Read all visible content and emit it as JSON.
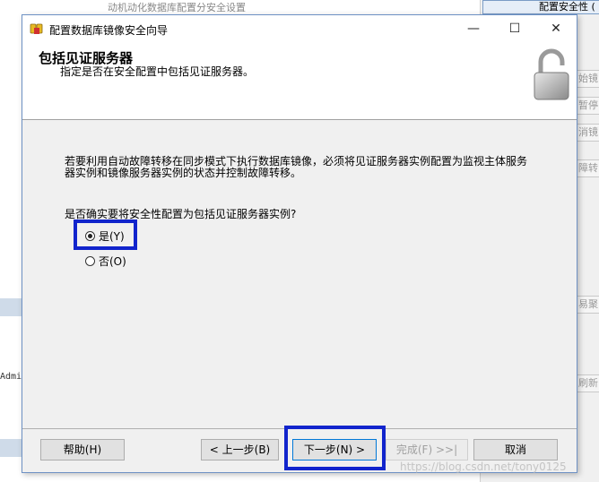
{
  "background": {
    "top_fragment": "动机动化数据库配置分安全设置",
    "right_tab": "配置安全性 (",
    "right_fragments": [
      "始镜",
      "暂停",
      "消镜",
      "障转",
      "易聚",
      "刷新"
    ],
    "left_text": "Admi"
  },
  "dialog": {
    "title": "配置数据库镜像安全向导",
    "minimize": "—",
    "maximize": "☐",
    "close": "✕",
    "header_title": "包括见证服务器",
    "header_subtitle": "指定是否在安全配置中包括见证服务器。",
    "description": "若要利用自动故障转移在同步模式下执行数据库镜像，必须将见证服务器实例配置为监视主体服务器实例和镜像服务器实例的状态并控制故障转移。",
    "question": "是否确实要将安全性配置为包括见证服务器实例?",
    "options": [
      {
        "label": "是(Y)",
        "checked": true
      },
      {
        "label": "否(O)",
        "checked": false
      }
    ],
    "buttons": {
      "help": "帮助(H)",
      "back": "< 上一步(B)",
      "next": "下一步(N) >",
      "finish": "完成(F) >>|",
      "cancel": "取消"
    }
  },
  "watermark": "https://blog.csdn.net/tony0125",
  "colors": {
    "highlight": "#1124cc",
    "dialog_border": "#6d91c4"
  }
}
